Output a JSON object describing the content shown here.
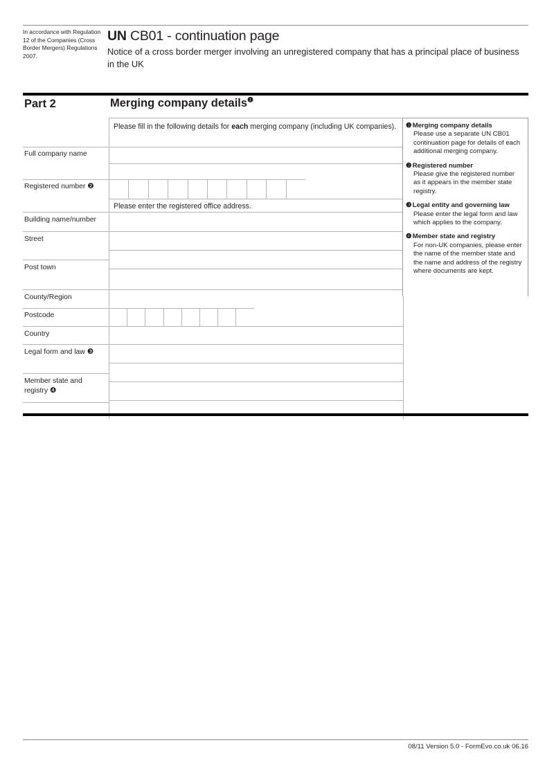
{
  "header": {
    "accordance_text": "In accordance with Regulation 12 of the Companies (Cross Border Mergers) Regulations 2007.",
    "title_bold": "UN",
    "title_rest": " CB01 - continuation page",
    "subtitle": "Notice of a cross border merger involving an unregistered company that has a principal place of business in the UK"
  },
  "part": {
    "label": "Part 2",
    "heading": "Merging company details",
    "heading_marker": "❶"
  },
  "form": {
    "instruction_top": "Please fill in the following details for ",
    "instruction_top_bold": "each",
    "instruction_top_end": " merging company (including UK companies).",
    "instruction_address": "Please enter the registered office address.",
    "labels": {
      "full_company_name": "Full company name",
      "registered_number": "Registered number",
      "registered_number_marker": "❷",
      "building": "Building name/number",
      "street": "Street",
      "post_town": "Post town",
      "county_region": "County/Region",
      "postcode": "Postcode",
      "country": "Country",
      "legal_form": "Legal form and law",
      "legal_form_marker": "❸",
      "member_state": "Member state and registry",
      "member_state_marker": "❹"
    },
    "values": {
      "full_company_name_line1": "",
      "full_company_name_line2": "",
      "registered_number": [
        "",
        "",
        "",
        "",
        "",
        "",
        "",
        "",
        "",
        ""
      ],
      "building": "",
      "street_line1": "",
      "street_line2": "",
      "post_town": "",
      "county_region": "",
      "postcode": [
        "",
        "",
        "",
        "",
        "",
        "",
        "",
        ""
      ],
      "country": "",
      "legal_form_line1": "",
      "legal_form_line2": "",
      "member_state_line1": "",
      "member_state_line2": ""
    },
    "registered_number_cell_count": 10,
    "postcode_cell_count": 8
  },
  "sidebar": {
    "notes": [
      {
        "marker": "❶",
        "title": "Merging company details",
        "body": "Please use a separate UN CB01 continuation page for details of each additional merging company."
      },
      {
        "marker": "❷",
        "title": "Registered number",
        "body": "Please give the registered number as it appears in the member state registry."
      },
      {
        "marker": "❸",
        "title": "Legal entity and governing law",
        "body": "Please enter the legal form and law which applies to the company."
      },
      {
        "marker": "❹",
        "title": "Member state and registry",
        "body": "For non-UK companies, please enter the name of the member state and the name and address of the registry where documents are kept."
      }
    ]
  },
  "footer": {
    "text": "08/11 Version 5.0 - FormEvo.co.uk 06.16"
  }
}
